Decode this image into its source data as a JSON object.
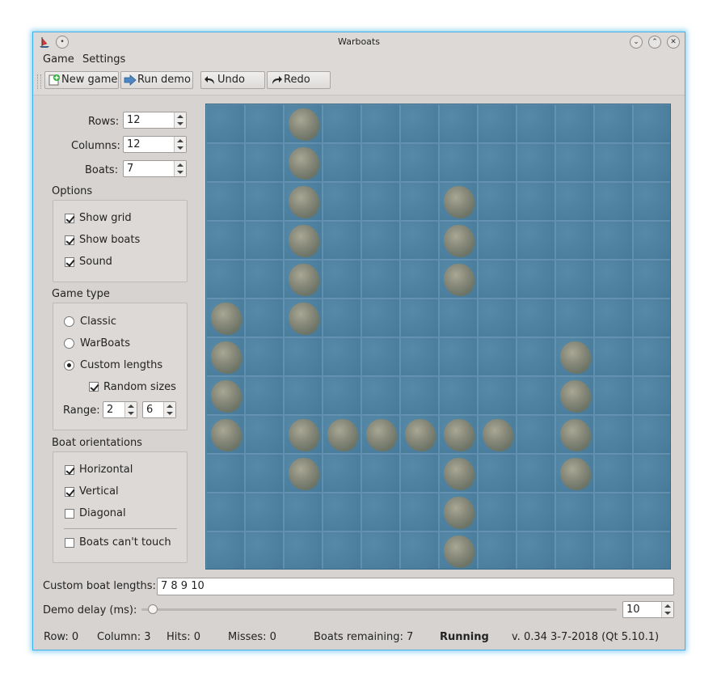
{
  "window": {
    "title": "Warboats"
  },
  "menu": {
    "game": "Game",
    "settings": "Settings"
  },
  "toolbar": {
    "new_game": "New game",
    "run_demo": "Run demo",
    "undo": "Undo",
    "redo": "Redo"
  },
  "settings": {
    "rows_label": "Rows:",
    "rows_value": "12",
    "columns_label": "Columns:",
    "columns_value": "12",
    "boats_label": "Boats:",
    "boats_value": "7"
  },
  "options": {
    "title": "Options",
    "show_grid": {
      "label": "Show grid",
      "checked": true
    },
    "show_boats": {
      "label": "Show boats",
      "checked": true
    },
    "sound": {
      "label": "Sound",
      "checked": true
    }
  },
  "game_type": {
    "title": "Game type",
    "classic": "Classic",
    "warboats": "WarBoats",
    "custom": "Custom lengths",
    "selected": "custom",
    "random_sizes": {
      "label": "Random sizes",
      "checked": true
    },
    "range_label": "Range:",
    "range_min": "2",
    "range_max": "6"
  },
  "orientations": {
    "title": "Boat orientations",
    "horizontal": {
      "label": "Horizontal",
      "checked": true
    },
    "vertical": {
      "label": "Vertical",
      "checked": true
    },
    "diagonal": {
      "label": "Diagonal",
      "checked": false
    },
    "no_touch": {
      "label": "Boats can't touch",
      "checked": false
    }
  },
  "board": {
    "rows": 12,
    "cols": 12,
    "rocks": [
      [
        0,
        2
      ],
      [
        1,
        2
      ],
      [
        2,
        2
      ],
      [
        3,
        2
      ],
      [
        4,
        2
      ],
      [
        5,
        2
      ],
      [
        2,
        6
      ],
      [
        3,
        6
      ],
      [
        4,
        6
      ],
      [
        5,
        0
      ],
      [
        6,
        0
      ],
      [
        7,
        0
      ],
      [
        8,
        0
      ],
      [
        8,
        2
      ],
      [
        8,
        3
      ],
      [
        8,
        4
      ],
      [
        8,
        5
      ],
      [
        8,
        6
      ],
      [
        8,
        7
      ],
      [
        6,
        9
      ],
      [
        7,
        9
      ],
      [
        8,
        9
      ],
      [
        9,
        9
      ],
      [
        9,
        2
      ],
      [
        9,
        6
      ],
      [
        10,
        6
      ],
      [
        11,
        6
      ]
    ]
  },
  "bottom": {
    "custom_lengths_label": "Custom boat lengths:",
    "custom_lengths_value": "7 8 9 10",
    "demo_delay_label": "Demo delay (ms):",
    "demo_delay_value": "10",
    "demo_delay_fraction": 0.01
  },
  "status": {
    "row": "Row: 0",
    "column": "Column: 3",
    "hits": "Hits: 0",
    "misses": "Misses: 0",
    "boats_remaining": "Boats remaining: 7",
    "state": "Running",
    "version": "v. 0.34  3-7-2018 (Qt 5.10.1)"
  },
  "colors": {
    "accent": "#3daee9",
    "water": "#4a80a1",
    "window_bg": "#d6d3d0"
  }
}
